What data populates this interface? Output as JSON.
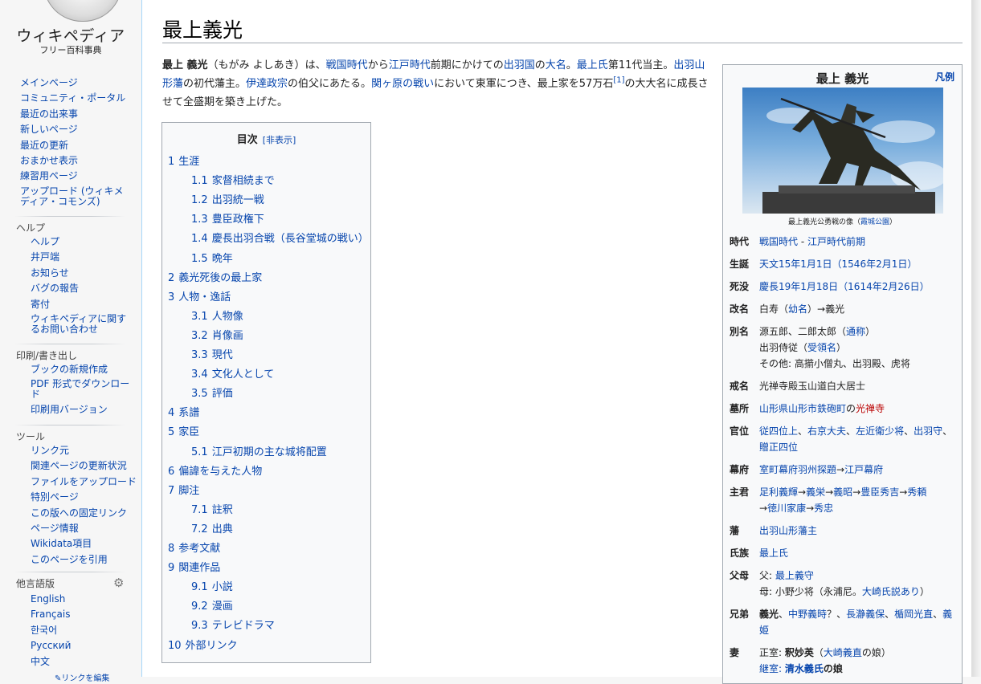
{
  "logo": {
    "title": "ウィキペディア",
    "subtitle": "フリー百科事典"
  },
  "sidebar": {
    "main": [
      "メインページ",
      "コミュニティ・ポータル",
      "最近の出来事",
      "新しいページ",
      "最近の更新",
      "おまかせ表示",
      "練習用ページ",
      "アップロード (ウィキメディア・コモンズ)"
    ],
    "help_title": "ヘルプ",
    "help": [
      "ヘルプ",
      "井戸端",
      "お知らせ",
      "バグの報告",
      "寄付",
      "ウィキペディアに関するお問い合わせ"
    ],
    "print_title": "印刷/書き出し",
    "print": [
      "ブックの新規作成",
      "PDF 形式でダウンロード",
      "印刷用バージョン"
    ],
    "tools_title": "ツール",
    "tools": [
      "リンク元",
      "関連ページの更新状況",
      "ファイルをアップロード",
      "特別ページ",
      "この版への固定リンク",
      "ページ情報",
      "Wikidata項目",
      "このページを引用"
    ],
    "lang_title": "他言語版",
    "langs": [
      "English",
      "Français",
      "한국어",
      "Русский",
      "中文"
    ],
    "lang_edit": "リンクを編集"
  },
  "article": {
    "title": "最上義光",
    "intro": {
      "b1": "最上 義光",
      "t1": "（もがみ よしあき）は、",
      "l1": "戦国時代",
      "t2": "から",
      "l2": "江戸時代",
      "t3": "前期にかけての",
      "l3": "出羽国",
      "t4": "の",
      "l4": "大名",
      "t5": "。",
      "l5": "最上氏",
      "t6": "第11代当主。",
      "l6": "出羽山形藩",
      "t7": "の初代藩主。",
      "l7": "伊達政宗",
      "t8": "の伯父にあたる。",
      "l8": "関ヶ原の戦い",
      "t9": "において東軍につき、最上家を57万石",
      "ref": "[1]",
      "t10": "の大大名に成長させて全盛期を築き上げた。"
    }
  },
  "toc": {
    "title": "目次",
    "hide": "[非表示]",
    "items": [
      {
        "num": "1",
        "label": "生涯",
        "level": 1
      },
      {
        "num": "1.1",
        "label": "家督相続まで",
        "level": 2
      },
      {
        "num": "1.2",
        "label": "出羽統一戦",
        "level": 2
      },
      {
        "num": "1.3",
        "label": "豊臣政権下",
        "level": 2
      },
      {
        "num": "1.4",
        "label": "慶長出羽合戦（長谷堂城の戦い）",
        "level": 2
      },
      {
        "num": "1.5",
        "label": "晩年",
        "level": 2
      },
      {
        "num": "2",
        "label": "義光死後の最上家",
        "level": 1
      },
      {
        "num": "3",
        "label": "人物・逸話",
        "level": 1
      },
      {
        "num": "3.1",
        "label": "人物像",
        "level": 2
      },
      {
        "num": "3.2",
        "label": "肖像画",
        "level": 2
      },
      {
        "num": "3.3",
        "label": "現代",
        "level": 2
      },
      {
        "num": "3.4",
        "label": "文化人として",
        "level": 2
      },
      {
        "num": "3.5",
        "label": "評価",
        "level": 2
      },
      {
        "num": "4",
        "label": "系譜",
        "level": 1
      },
      {
        "num": "5",
        "label": "家臣",
        "level": 1
      },
      {
        "num": "5.1",
        "label": "江戸初期の主な城将配置",
        "level": 2
      },
      {
        "num": "6",
        "label": "偏諱を与えた人物",
        "level": 1
      },
      {
        "num": "7",
        "label": "脚注",
        "level": 1
      },
      {
        "num": "7.1",
        "label": "註釈",
        "level": 2
      },
      {
        "num": "7.2",
        "label": "出典",
        "level": 2
      },
      {
        "num": "8",
        "label": "参考文献",
        "level": 1
      },
      {
        "num": "9",
        "label": "関連作品",
        "level": 1
      },
      {
        "num": "9.1",
        "label": "小説",
        "level": 2
      },
      {
        "num": "9.2",
        "label": "漫画",
        "level": 2
      },
      {
        "num": "9.3",
        "label": "テレビドラマ",
        "level": 2
      },
      {
        "num": "10",
        "label": "外部リンク",
        "level": 1
      }
    ]
  },
  "infobox": {
    "name": "最上 義光",
    "legend": "凡例",
    "caption_a": "最上義光公勇戦の像（",
    "caption_link": "霞城公園",
    "caption_b": "）",
    "rows": {
      "era_k": "時代",
      "era_v1": "戦国時代",
      "era_sep": " - ",
      "era_v2": "江戸時代前期",
      "birth_k": "生誕",
      "birth_v": "天文15年1月1日（1546年2月1日）",
      "death_k": "死没",
      "death_v": "慶長19年1月18日（1614年2月26日）",
      "rename_k": "改名",
      "rename_a": "白寿（",
      "rename_l": "幼名",
      "rename_b": "）→義光",
      "alias_k": "別名",
      "alias_1a": "源五郎、二郎太郎（",
      "alias_1l": "通称",
      "alias_1b": "）",
      "alias_2a": "出羽侍従（",
      "alias_2l": "受領名",
      "alias_2b": "）",
      "alias_3": "その他: 高擶小僧丸、出羽殿、虎将",
      "kaimyo_k": "戒名",
      "kaimyo_v": "光禅寺殿玉山道白大居士",
      "grave_k": "墓所",
      "grave_l": "山形県山形市鉄砲町",
      "grave_t": "の",
      "grave_r": "光禅寺",
      "rank_k": "官位",
      "rank_l1": "従四位上",
      "rank_s1": "、",
      "rank_l2": "右京大夫",
      "rank_s2": "、",
      "rank_l3": "左近衛少将",
      "rank_s3": "、",
      "rank_l4": "出羽守",
      "rank_s4": "、",
      "rank_l5": "贈正四位",
      "bakufu_k": "幕府",
      "bakufu_l1": "室町幕府羽州探題",
      "bakufu_s": "→",
      "bakufu_l2": "江戸幕府",
      "lord_k": "主君",
      "lord_l1": "足利義輝",
      "lord_l2": "義栄",
      "lord_l3": "義昭",
      "lord_l4": "豊臣秀吉",
      "lord_l5": "秀頼",
      "lord_l6": "徳川家康",
      "lord_l7": "秀忠",
      "arrow": "→",
      "han_k": "藩",
      "han_v": "出羽山形藩主",
      "clan_k": "氏族",
      "clan_v": "最上氏",
      "parent_k": "父母",
      "parent_1a": "父: ",
      "parent_1l": "最上義守",
      "parent_2a": "母: 小野少将（永浦尼。",
      "parent_2l": "大崎氏説あり",
      "parent_2b": "）",
      "sib_k": "兄弟",
      "sib_b": "義光",
      "sib_s": "、",
      "sib_l1": "中野義時",
      "sib_q": "？",
      "sib_l2": "長瀞義保",
      "sib_l3": "楯岡光直",
      "sib_l4": "義姫",
      "wife_k": "妻",
      "wife_1a": "正室: ",
      "wife_1b": "釈妙英",
      "wife_1c": "（",
      "wife_1l": "大崎義直",
      "wife_1d": "の娘）",
      "wife_2a": "継室: ",
      "wife_2l": "清水義氏",
      "wife_2b": "の娘"
    }
  }
}
